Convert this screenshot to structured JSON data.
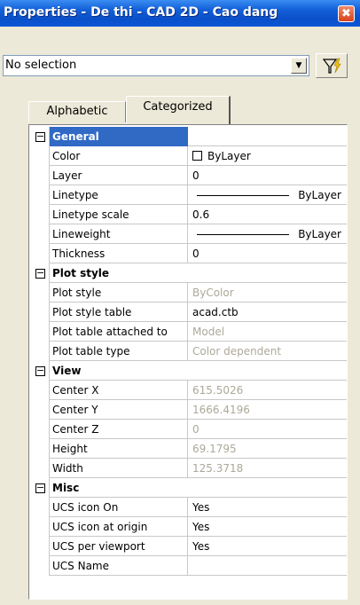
{
  "window": {
    "title": "Properties - De thi - CAD 2D - Cao dang",
    "close_symbol": "✖"
  },
  "selector": {
    "value": "No selection",
    "arrow": "▼"
  },
  "tabs": [
    {
      "label": "Alphabetic"
    },
    {
      "label": "Categorized"
    }
  ],
  "categories": [
    {
      "label": "General",
      "toggle": "−",
      "properties": [
        {
          "name": "Color",
          "value": "ByLayer"
        },
        {
          "name": "Layer",
          "value": "0"
        },
        {
          "name": "Linetype",
          "value": "ByLayer"
        },
        {
          "name": "Linetype scale",
          "value": "0.6"
        },
        {
          "name": "Lineweight",
          "value": "ByLayer"
        },
        {
          "name": "Thickness",
          "value": "0"
        }
      ]
    },
    {
      "label": "Plot style",
      "toggle": "−",
      "properties": [
        {
          "name": "Plot style",
          "value": "ByColor"
        },
        {
          "name": "Plot style table",
          "value": "acad.ctb"
        },
        {
          "name": "Plot table attached to",
          "value": "Model"
        },
        {
          "name": "Plot table type",
          "value": "Color dependent"
        }
      ]
    },
    {
      "label": "View",
      "toggle": "−",
      "properties": [
        {
          "name": "Center X",
          "value": "615.5026"
        },
        {
          "name": "Center Y",
          "value": "1666.4196"
        },
        {
          "name": "Center Z",
          "value": "0"
        },
        {
          "name": "Height",
          "value": "69.1795"
        },
        {
          "name": "Width",
          "value": "125.3718"
        }
      ]
    },
    {
      "label": "Misc",
      "toggle": "−",
      "properties": [
        {
          "name": "UCS icon On",
          "value": "Yes"
        },
        {
          "name": "UCS icon at origin",
          "value": "Yes"
        },
        {
          "name": "UCS per viewport",
          "value": "Yes"
        },
        {
          "name": "UCS Name",
          "value": ""
        }
      ]
    }
  ]
}
